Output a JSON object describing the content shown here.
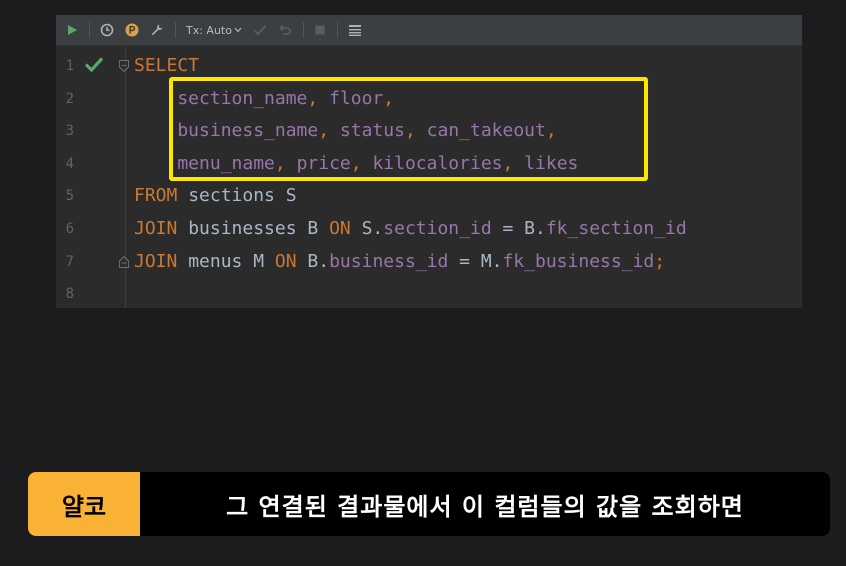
{
  "toolbar": {
    "tx_mode": "Tx: Auto",
    "icons": [
      "run-icon",
      "history-icon",
      "profile-icon",
      "wrench-icon",
      "tx-dropdown-icon",
      "commit-icon",
      "rollback-icon",
      "stop-icon",
      "output-layout-icon"
    ]
  },
  "editor": {
    "line_numbers": [
      "1",
      "2",
      "3",
      "4",
      "5",
      "6",
      "7",
      "8"
    ],
    "lines": [
      [
        {
          "t": "SELECT",
          "c": "kw"
        }
      ],
      [
        {
          "t": "    section_name",
          "c": "col"
        },
        {
          "t": ", ",
          "c": "kw"
        },
        {
          "t": "floor",
          "c": "col"
        },
        {
          "t": ",",
          "c": "kw"
        }
      ],
      [
        {
          "t": "    business_name",
          "c": "col"
        },
        {
          "t": ", ",
          "c": "kw"
        },
        {
          "t": "status",
          "c": "col"
        },
        {
          "t": ", ",
          "c": "kw"
        },
        {
          "t": "can_takeout",
          "c": "col"
        },
        {
          "t": ",",
          "c": "kw"
        }
      ],
      [
        {
          "t": "    menu_name",
          "c": "col"
        },
        {
          "t": ", ",
          "c": "kw"
        },
        {
          "t": "price",
          "c": "col"
        },
        {
          "t": ", ",
          "c": "kw"
        },
        {
          "t": "kilocalories",
          "c": "col"
        },
        {
          "t": ", ",
          "c": "kw"
        },
        {
          "t": "likes",
          "c": "col"
        }
      ],
      [
        {
          "t": "FROM ",
          "c": "kw"
        },
        {
          "t": "sections S",
          "c": "plain"
        }
      ],
      [
        {
          "t": "JOIN ",
          "c": "kw"
        },
        {
          "t": "businesses B ",
          "c": "plain"
        },
        {
          "t": "ON ",
          "c": "kw"
        },
        {
          "t": "S.",
          "c": "plain"
        },
        {
          "t": "section_id",
          "c": "col"
        },
        {
          "t": " = B.",
          "c": "plain"
        },
        {
          "t": "fk_section_id",
          "c": "col"
        }
      ],
      [
        {
          "t": "JOIN ",
          "c": "kw"
        },
        {
          "t": "menus M ",
          "c": "plain"
        },
        {
          "t": "ON ",
          "c": "kw"
        },
        {
          "t": "B.",
          "c": "plain"
        },
        {
          "t": "business_id",
          "c": "col"
        },
        {
          "t": " = M.",
          "c": "plain"
        },
        {
          "t": "fk_business_id",
          "c": "col"
        },
        {
          "t": ";",
          "c": "kw"
        }
      ],
      []
    ],
    "colors": {
      "keyword": "#cc7832",
      "column": "#9876aa",
      "plain": "#a9b7c6",
      "highlight": "#ffe600"
    }
  },
  "subtitle": {
    "speaker": "얄코",
    "caption": "그 연결된 결과물에서 이 컬럼들의 값을 조회하면",
    "speaker_color": "#f9b233"
  }
}
